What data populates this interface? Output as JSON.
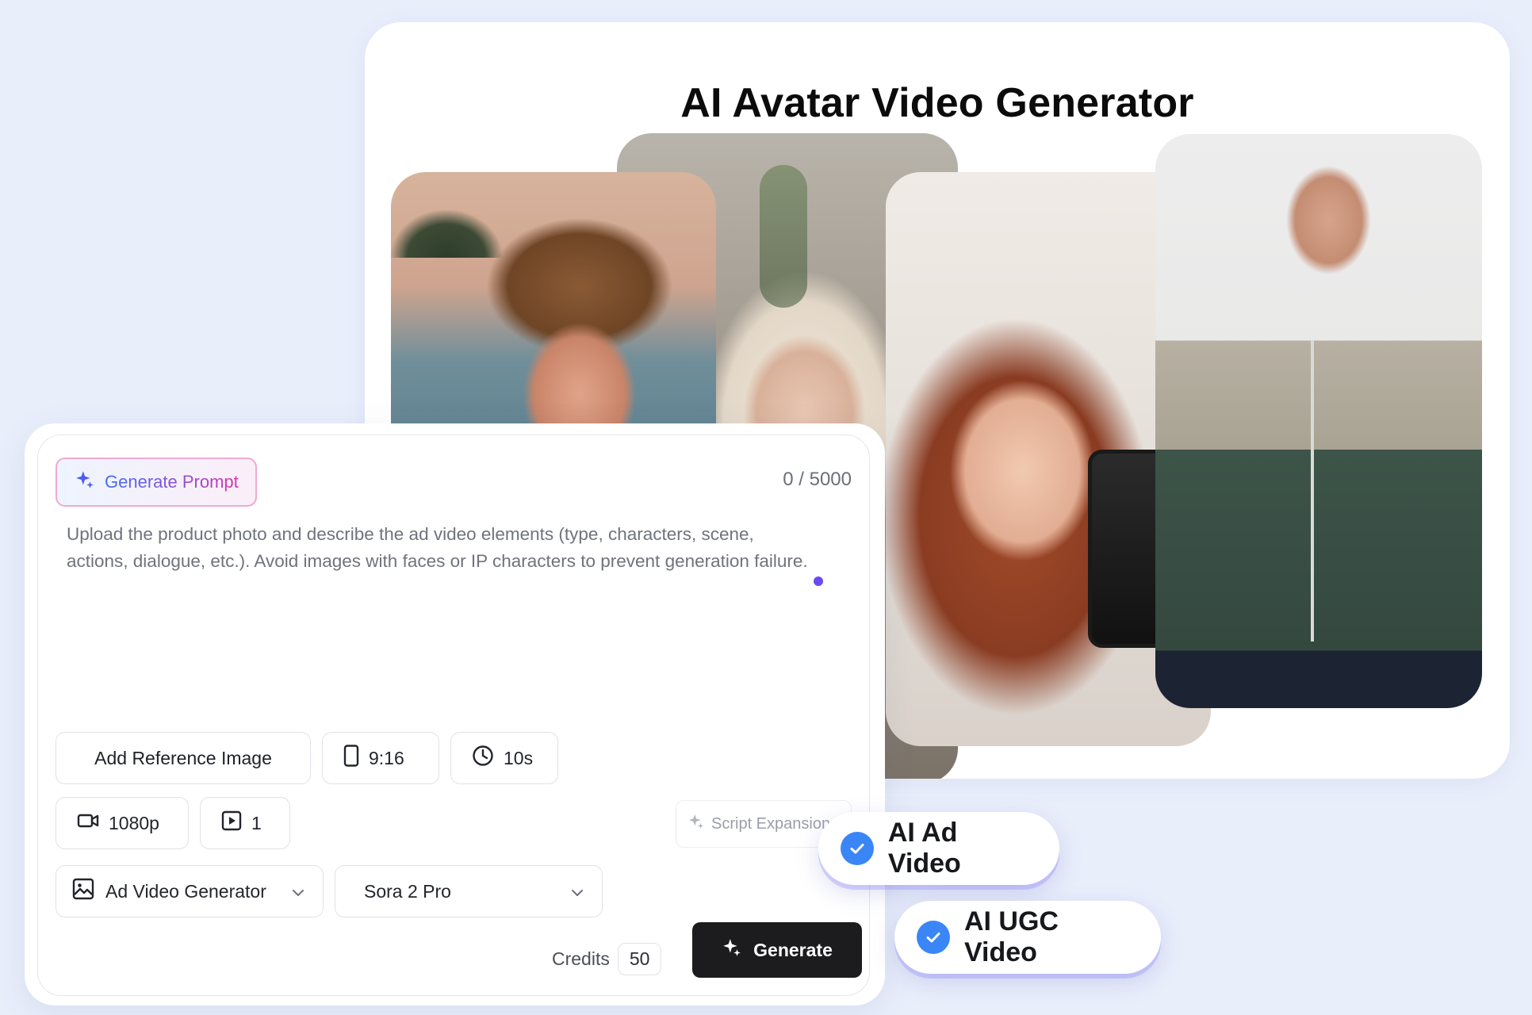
{
  "showcase": {
    "title": "AI Avatar Video Generator",
    "photos": [
      "young-man-beach",
      "blonde-woman",
      "red-hair-woman-phone",
      "man-holding-hoodie"
    ]
  },
  "prompt_panel": {
    "generate_prompt_label": "Generate Prompt",
    "char_count": "0 / 5000",
    "placeholder": "Upload the product photo and describe the ad video elements (type, characters, scene, actions, dialogue, etc.). Avoid images with faces or IP characters to prevent generation failure.",
    "add_reference_label": "Add Reference Image",
    "aspect_ratio": "9:16",
    "duration": "10s",
    "resolution": "1080p",
    "video_count": "1",
    "script_expansion_label": "Script Expansion",
    "mode_select": "Ad Video Generator",
    "model_select": "Sora 2 Pro",
    "credits_label": "Credits",
    "credits_value": "50",
    "generate_label": "Generate"
  },
  "badges": {
    "ad_video": "AI Ad Video",
    "ugc_video": "AI UGC Video"
  },
  "colors": {
    "background": "#e9eefb",
    "accent_blue": "#3a86f7",
    "generate_button": "#1c1c1e",
    "prompt_gradient_start": "#3d6ef5",
    "prompt_gradient_end": "#d437b3"
  },
  "icons": [
    "sparkle-icon",
    "phone-portrait-icon",
    "clock-icon",
    "video-camera-icon",
    "play-box-icon",
    "image-gallery-icon",
    "chevron-down-icon",
    "check-icon"
  ]
}
